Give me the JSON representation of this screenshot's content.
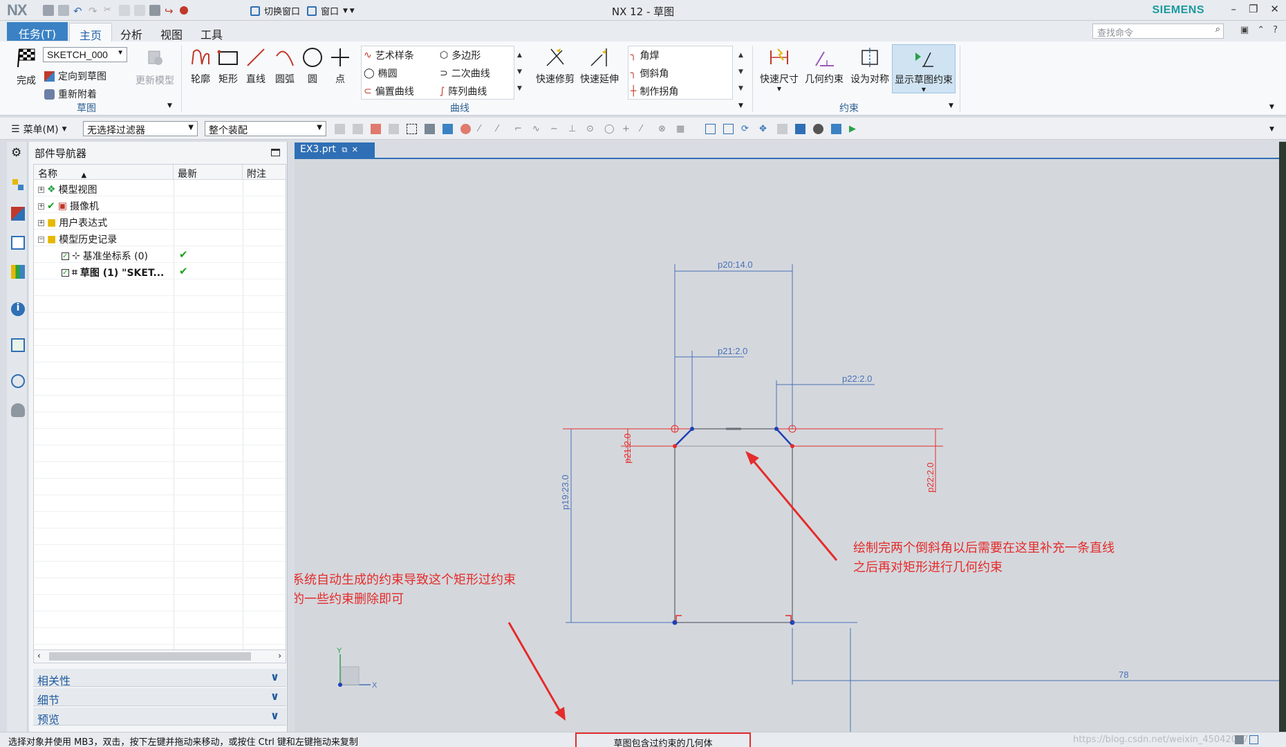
{
  "app": {
    "logo": "NX",
    "title": "NX 12 - 草图",
    "brand": "SIEMENS",
    "switch_window": "切换窗口",
    "window_menu": "窗口"
  },
  "tabs": [
    {
      "label": "任务(T)"
    },
    {
      "label": "主页"
    },
    {
      "label": "分析"
    },
    {
      "label": "视图"
    },
    {
      "label": "工具"
    }
  ],
  "search_placeholder": "查找命令",
  "ribbon": {
    "finish": "完成",
    "sketch_name": "SKETCH_000",
    "orient_to_sketch": "定向到草图",
    "reattach": "重新附着",
    "update_model": "更新模型",
    "group_sketch": "草图",
    "curve_tools": [
      {
        "label": "轮廓"
      },
      {
        "label": "矩形"
      },
      {
        "label": "直线"
      },
      {
        "label": "圆弧"
      },
      {
        "label": "圆"
      },
      {
        "label": "点"
      }
    ],
    "gallery_left": [
      "艺术样条",
      "椭圆",
      "偏置曲线"
    ],
    "gallery_right": [
      "多边形",
      "二次曲线",
      "阵列曲线"
    ],
    "group_curve": "曲线",
    "quick_trim": "快速修剪",
    "quick_extend": "快速延伸",
    "corner_list": [
      "角焊",
      "倒斜角",
      "制作拐角"
    ],
    "rapid_dimension": "快速尺寸",
    "geometric_constraints": "几何约束",
    "make_symmetric": "设为对称",
    "display_sketch_constraints": "显示草图约束",
    "group_constraint": "约束"
  },
  "selection_bar": {
    "menu": "菜单(M)",
    "filter": "无选择过滤器",
    "scope": "整个装配"
  },
  "navigator": {
    "title": "部件导航器",
    "columns": [
      "名称",
      "最新",
      "附注"
    ],
    "rows": [
      {
        "name": "模型视图",
        "latest": ""
      },
      {
        "name": "摄像机",
        "latest": ""
      },
      {
        "name": "用户表达式",
        "latest": ""
      },
      {
        "name": "模型历史记录",
        "latest": ""
      },
      {
        "name": "基准坐标系 (0)",
        "latest": "✔"
      },
      {
        "name": "草图 (1) \"SKET...",
        "latest": "✔"
      }
    ],
    "panels": [
      "相关性",
      "细节",
      "预览"
    ]
  },
  "graphics": {
    "file_tab": "EX3.prt",
    "dimensions": {
      "top_width": "p20:14.0",
      "left_chamfer": "p21:2.0",
      "right_chamfer": "p22:2.0",
      "height": "p19:23.0",
      "left_vertical_chamfer": "p21:2.0",
      "right_vertical_chamfer": "p22:2.0",
      "bottom_right": "78"
    },
    "annotation_right": [
      "绘制完两个倒斜角以后需要在这里补充一条直线",
      "之后再对矩形进行几何约束"
    ],
    "annotation_left": [
      "这里由于有系统自动生成的约束导致这个矩形过约束",
      "将系统生成的一些约束删除即可"
    ],
    "axis_x": "X",
    "axis_y": "Y"
  },
  "status": {
    "message": "选择对象并使用 MB3，双击，按下左键并拖动来移动，或按住 Ctrl 键和左键拖动来复制",
    "center": "草图包含过约束的几何体",
    "watermark": "https://blog.csdn.net/weixin_45042097"
  },
  "colors": {
    "accent": "#3b82c4",
    "dimension_blue": "#4a6fb5",
    "constraint_red": "#e52b2b",
    "annotation_red": "#e52b2b"
  }
}
